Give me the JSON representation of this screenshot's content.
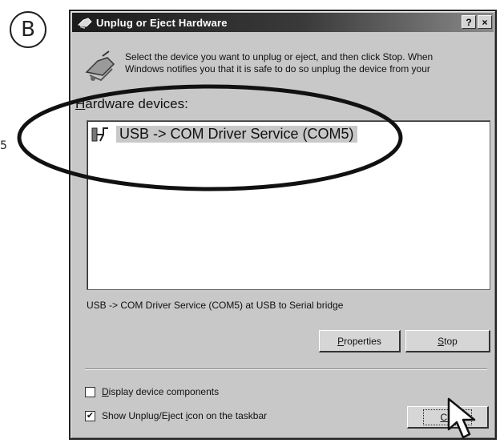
{
  "badge": "B",
  "side_number": "5",
  "window": {
    "title": "Unplug or Eject Hardware",
    "help_btn": "?",
    "close_btn": "×"
  },
  "intro": {
    "line1": "Select the device you want to unplug or eject, and then click Stop. When",
    "line2": "Windows notifies you that it is safe to do so unplug the device from your"
  },
  "hardware_label_accel": "H",
  "hardware_label_rest": "ardware devices:",
  "devices": [
    {
      "label": "USB -> COM Driver Service (COM5)"
    }
  ],
  "device_description": "USB -> COM Driver Service (COM5) at USB to Serial bridge",
  "buttons": {
    "properties_accel": "P",
    "properties_rest": "roperties",
    "stop_accel": "S",
    "stop_rest": "top",
    "close_partial": "Clo"
  },
  "checkboxes": [
    {
      "accel": "D",
      "rest": "isplay device components",
      "checked": false
    },
    {
      "pre": "Show Unplug/Eject ",
      "accel": "i",
      "rest": "con on the taskbar",
      "checked": true
    }
  ],
  "colors": {
    "window_bg": "#c8c8c8",
    "titlebar": "#1c1c1c",
    "list_bg": "#ffffff"
  },
  "icons": [
    "badge-circle",
    "hardware-icon",
    "usb-device-icon",
    "mouse-cursor-icon"
  ]
}
